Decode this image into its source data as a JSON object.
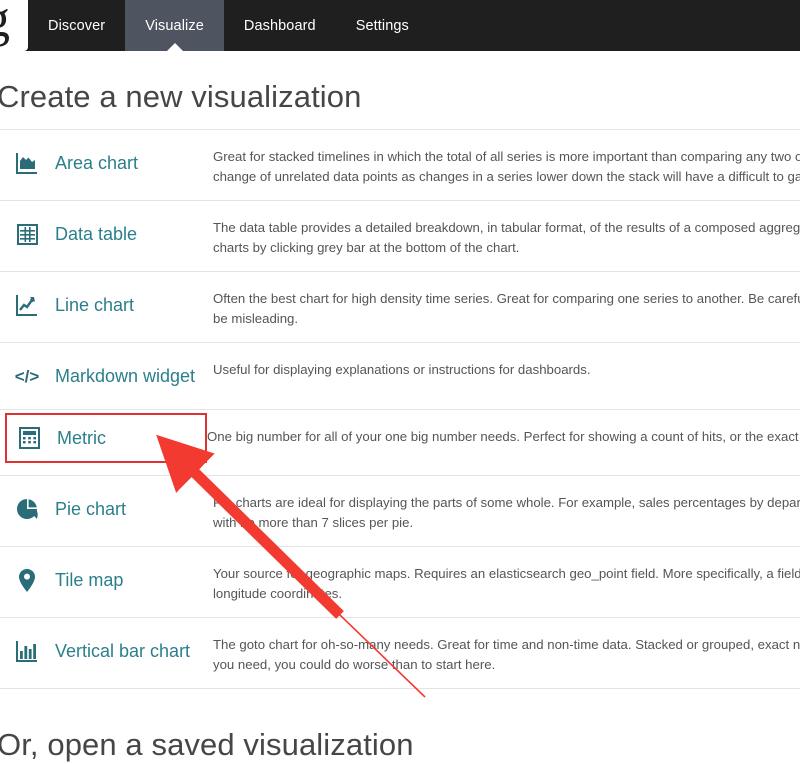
{
  "navbar": {
    "logo_glyph": "g",
    "items": [
      {
        "label": "Discover",
        "active": false
      },
      {
        "label": "Visualize",
        "active": true
      },
      {
        "label": "Dashboard",
        "active": false
      },
      {
        "label": "Settings",
        "active": false
      }
    ]
  },
  "main": {
    "create_title": "Create a new visualization",
    "saved_title": "Or, open a saved visualization",
    "vis_types": [
      {
        "icon": "area-chart-icon",
        "name": "Area chart",
        "desc_line1": "Great for stacked timelines in which the total of all series is more important than comparing any two or",
        "desc_line2": "change of unrelated data points as changes in a series lower down the stack will have a difficult to gau",
        "highlighted": false
      },
      {
        "icon": "data-table-icon",
        "name": "Data table",
        "desc_line1": "The data table provides a detailed breakdown, in tabular format, of the results of a composed aggrega",
        "desc_line2": "charts by clicking grey bar at the bottom of the chart.",
        "highlighted": false
      },
      {
        "icon": "line-chart-icon",
        "name": "Line chart",
        "desc_line1": "Often the best chart for high density time series. Great for comparing one series to another. Be careful",
        "desc_line2": "be misleading.",
        "highlighted": false
      },
      {
        "icon": "markdown-icon",
        "name": "Markdown widget",
        "desc_line1": "Useful for displaying explanations or instructions for dashboards.",
        "desc_line2": "",
        "highlighted": false
      },
      {
        "icon": "calculator-icon",
        "name": "Metric",
        "desc_line1": "One big number for all of your one big number needs. Perfect for showing a count of hits, or the exact",
        "desc_line2": "",
        "highlighted": true
      },
      {
        "icon": "pie-chart-icon",
        "name": "Pie chart",
        "desc_line1": "Pie charts are ideal for displaying the parts of some whole. For example, sales percentages by departm",
        "desc_line2": "with no more than 7 slices per pie.",
        "highlighted": false
      },
      {
        "icon": "map-marker-icon",
        "name": "Tile map",
        "desc_line1": "Your source for geographic maps. Requires an elasticsearch geo_point field. More specifically, a field",
        "desc_line2": "longitude coordinates.",
        "highlighted": false
      },
      {
        "icon": "bar-chart-icon",
        "name": "Vertical bar chart",
        "desc_line1": "The goto chart for oh-so-many needs. Great for time and non-time data. Stacked or grouped, exact nu",
        "desc_line2": "you need, you could do worse than to start here.",
        "highlighted": false
      }
    ]
  },
  "annotation": {
    "arrow_color": "#f23a30",
    "highlight_color": "#e03131"
  },
  "colors": {
    "navbar_bg": "#1f1f1f",
    "nav_active_bg": "#4e5561",
    "link_teal": "#2b7f8c",
    "icon_teal": "#2b6c79",
    "heading_gray": "#464646"
  }
}
